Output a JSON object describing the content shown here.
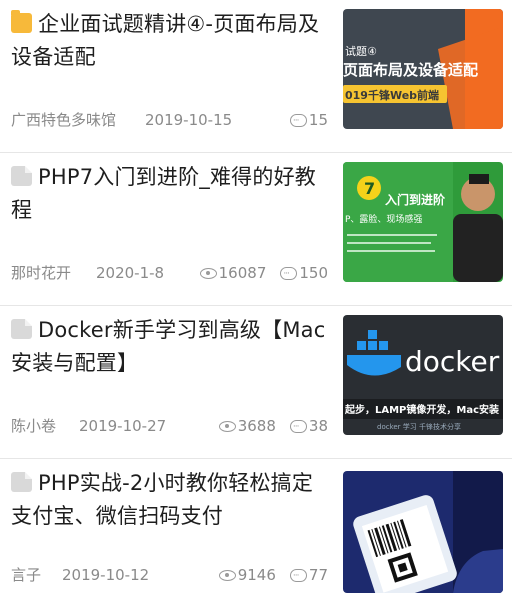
{
  "articles": [
    {
      "title": "企业面试题精讲④-页面布局及设备适配",
      "icon": "folder-icon",
      "author": "广西特色多味馆",
      "date": "2019-10-15",
      "views": "",
      "comments": "15",
      "thumb": {
        "line1": "试题④",
        "line2": "页面布局及设备适配",
        "line3": "019千锋Web前端"
      }
    },
    {
      "title": "PHP7入门到进阶_难得的好教程",
      "icon": "document-icon",
      "author": "那时花开",
      "date": "2020-1-8",
      "views": "16087",
      "comments": "150",
      "thumb": {
        "line1": "入门到进阶",
        "line2": "P、露脸、现场感强",
        "line3": "7"
      }
    },
    {
      "title": "Docker新手学习到高级【Mac安装与配置】",
      "icon": "document-icon",
      "author": "陈小卷",
      "date": "2019-10-27",
      "views": "3688",
      "comments": "38",
      "thumb": {
        "line1": "docker",
        "line2": "起步，LAMP镜像开发，Mac安装",
        "line3": "docker 学习 千锋技术分享"
      }
    },
    {
      "title": "PHP实战-2小时教你轻松搞定支付宝、微信扫码支付",
      "icon": "document-icon",
      "author": "言子",
      "date": "2019-10-12",
      "views": "9146",
      "comments": "77",
      "thumb": {}
    }
  ]
}
